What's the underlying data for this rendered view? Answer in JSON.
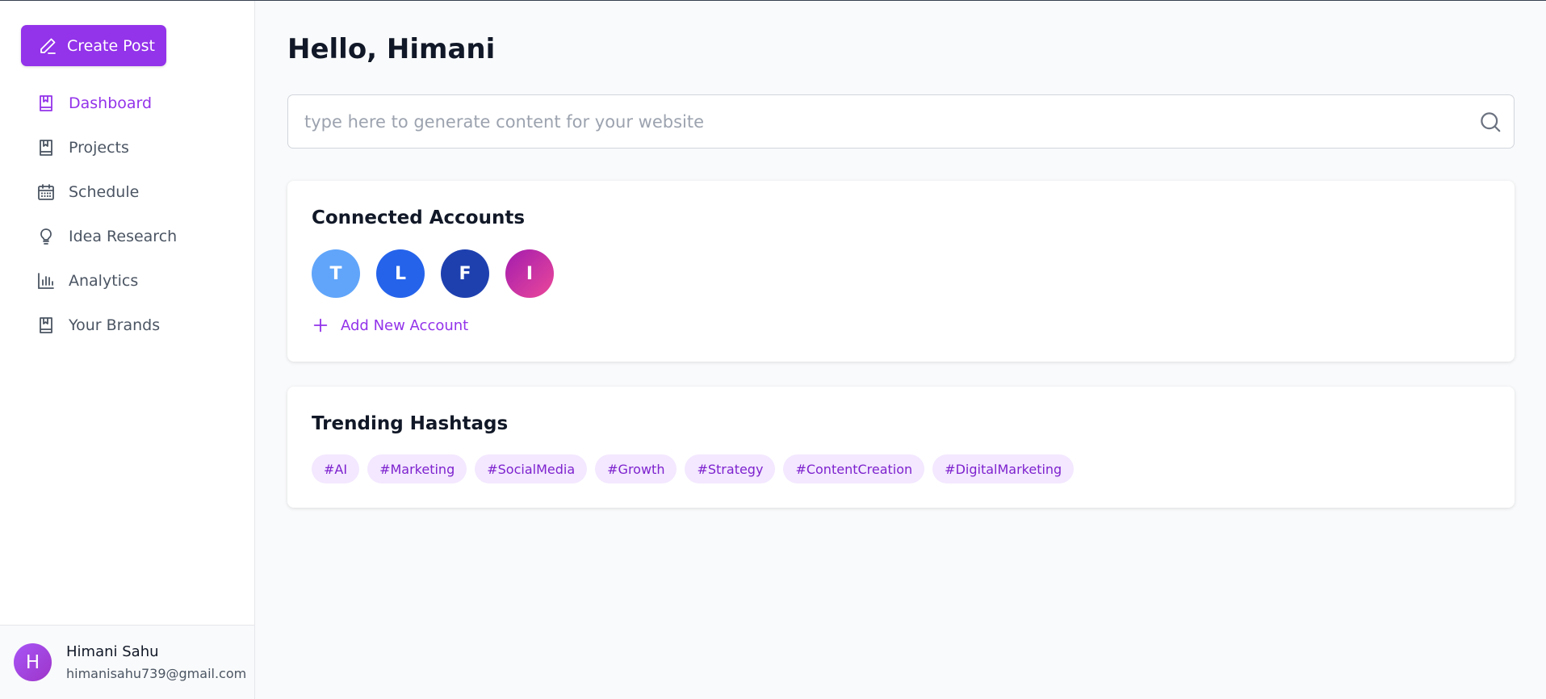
{
  "sidebar": {
    "create_label": "Create Post",
    "items": [
      {
        "label": "Dashboard",
        "icon": "book-icon",
        "active": true
      },
      {
        "label": "Projects",
        "icon": "book-icon",
        "active": false
      },
      {
        "label": "Schedule",
        "icon": "calendar-icon",
        "active": false
      },
      {
        "label": "Idea Research",
        "icon": "lightbulb-icon",
        "active": false
      },
      {
        "label": "Analytics",
        "icon": "bar-chart-icon",
        "active": false
      },
      {
        "label": "Your Brands",
        "icon": "book-icon",
        "active": false
      }
    ],
    "user": {
      "initial": "H",
      "name": "Himani Sahu",
      "email": "himanisahu739@gmail.com"
    }
  },
  "main": {
    "greeting": "Hello, Himani",
    "search": {
      "placeholder": "type here to generate content for your website"
    },
    "connected_accounts": {
      "title": "Connected Accounts",
      "accounts": [
        {
          "letter": "T",
          "color": "#60a5fa"
        },
        {
          "letter": "L",
          "color": "#2563eb"
        },
        {
          "letter": "F",
          "color": "#1e40af"
        },
        {
          "letter": "I",
          "color": "#c026d3"
        }
      ],
      "add_label": "Add New Account"
    },
    "trending": {
      "title": "Trending Hashtags",
      "tags": [
        "#AI",
        "#Marketing",
        "#SocialMedia",
        "#Growth",
        "#Strategy",
        "#ContentCreation",
        "#DigitalMarketing"
      ]
    }
  },
  "colors": {
    "accent": "#9333ea",
    "tag_bg": "#f3e8ff",
    "tag_text": "#7e22ce"
  }
}
